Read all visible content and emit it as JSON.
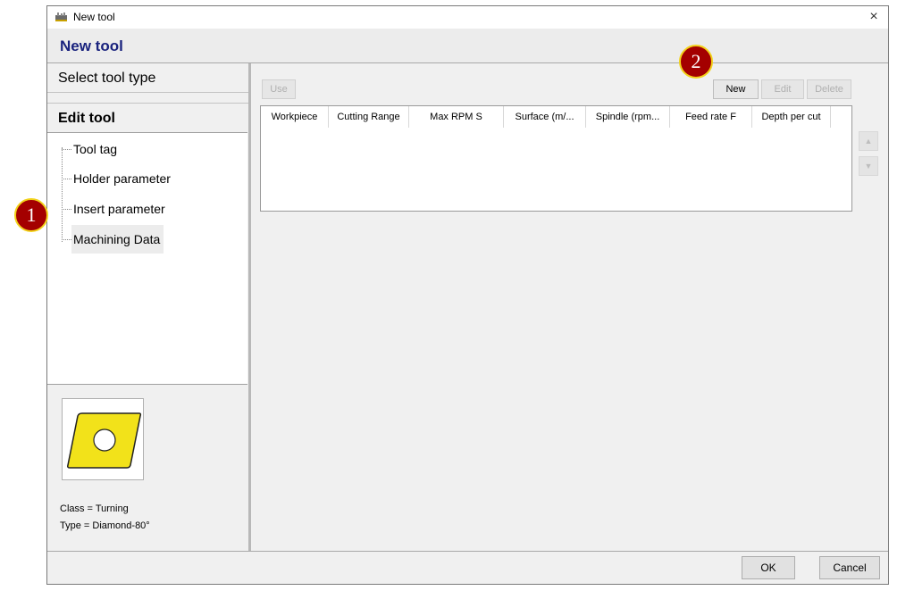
{
  "window": {
    "title": "New tool",
    "heading": "New tool",
    "close_glyph": "×",
    "app_icon": "toolbox-icon"
  },
  "steps": [
    {
      "label": "Select tool type"
    },
    {
      "label": "Edit tool"
    }
  ],
  "tree": {
    "items": [
      {
        "label": "Tool tag"
      },
      {
        "label": "Holder parameter"
      },
      {
        "label": "Insert parameter"
      },
      {
        "label": "Machining Data"
      }
    ]
  },
  "tool_preview": {
    "icon": "diamond-insert-icon",
    "fill_color": "#f2e21a",
    "class_text": "Class = Turning",
    "type_text": "Type = Diamond-80°"
  },
  "toolbar": {
    "use_label": "Use",
    "new_label": "New",
    "edit_label": "Edit",
    "delete_label": "Delete"
  },
  "table": {
    "columns": [
      "Workpiece",
      "Cutting Range",
      "Max RPM S",
      "Surface (m/...",
      "Spindle (rpm...",
      "Feed rate F",
      "Depth per cut"
    ],
    "rows": []
  },
  "side_buttons": {
    "up_icon": "arrow-up-icon",
    "down_icon": "arrow-down-icon",
    "up_glyph": "▲",
    "down_glyph": "▼"
  },
  "footer": {
    "ok_label": "OK",
    "cancel_label": "Cancel"
  },
  "annotations": [
    {
      "label": "1"
    },
    {
      "label": "2"
    }
  ],
  "colors": {
    "heading": "#1a237e",
    "badge_fill": "#a40000",
    "badge_ring": "#f2d21a"
  }
}
